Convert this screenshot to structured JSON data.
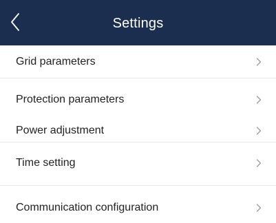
{
  "header": {
    "title": "Settings",
    "back_icon": "chevron-left-icon"
  },
  "items": [
    {
      "label": "Grid parameters",
      "icon": "chevron-right-icon"
    },
    {
      "label": "Protection parameters",
      "icon": "chevron-right-icon"
    },
    {
      "label": "Power adjustment",
      "icon": "chevron-right-icon"
    },
    {
      "label": "Time setting",
      "icon": "chevron-right-icon"
    },
    {
      "label": "Communication configuration",
      "icon": "chevron-right-icon"
    }
  ],
  "colors": {
    "header_bg": "#1c2e50",
    "header_text": "#ffffff",
    "text": "#222222",
    "chevron": "#9a9a9a",
    "divider": "#e9e9e9"
  }
}
